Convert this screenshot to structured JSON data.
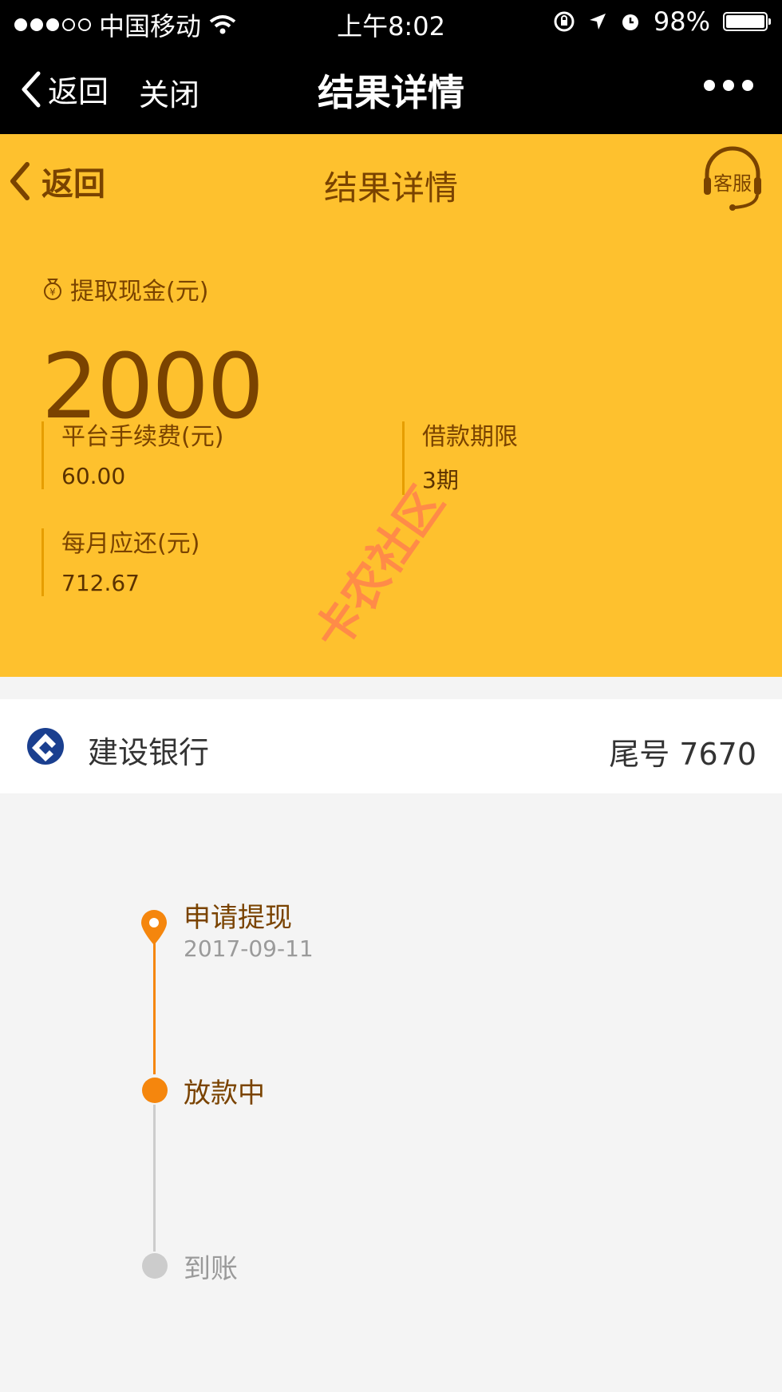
{
  "status_bar": {
    "carrier": "中国移动",
    "time": "上午8:02",
    "battery": "98%"
  },
  "wechat_nav": {
    "back_label": "返回",
    "close_label": "关闭",
    "title": "结果详情"
  },
  "page_header": {
    "back_label": "返回",
    "title": "结果详情",
    "service_label": "客服"
  },
  "summary": {
    "cash_label": "提取现金(元)",
    "cash_amount": "2000",
    "fee_label": "平台手续费(元)",
    "fee_value": "60.00",
    "term_label": "借款期限",
    "term_value": "3期",
    "monthly_label": "每月应还(元)",
    "monthly_value": "712.67"
  },
  "bank": {
    "name": "建设银行",
    "tail": "尾号 7670"
  },
  "timeline": {
    "steps": [
      {
        "label": "申请提现",
        "date": "2017-09-11",
        "state": "done"
      },
      {
        "label": "放款中",
        "state": "active"
      },
      {
        "label": "到账",
        "state": "pending"
      }
    ]
  },
  "colors": {
    "hero_bg": "#fec12e",
    "brown_text": "#7a4300",
    "accent_orange": "#f5860d",
    "pending_gray": "#cccccc"
  },
  "watermark": "卡农社区"
}
